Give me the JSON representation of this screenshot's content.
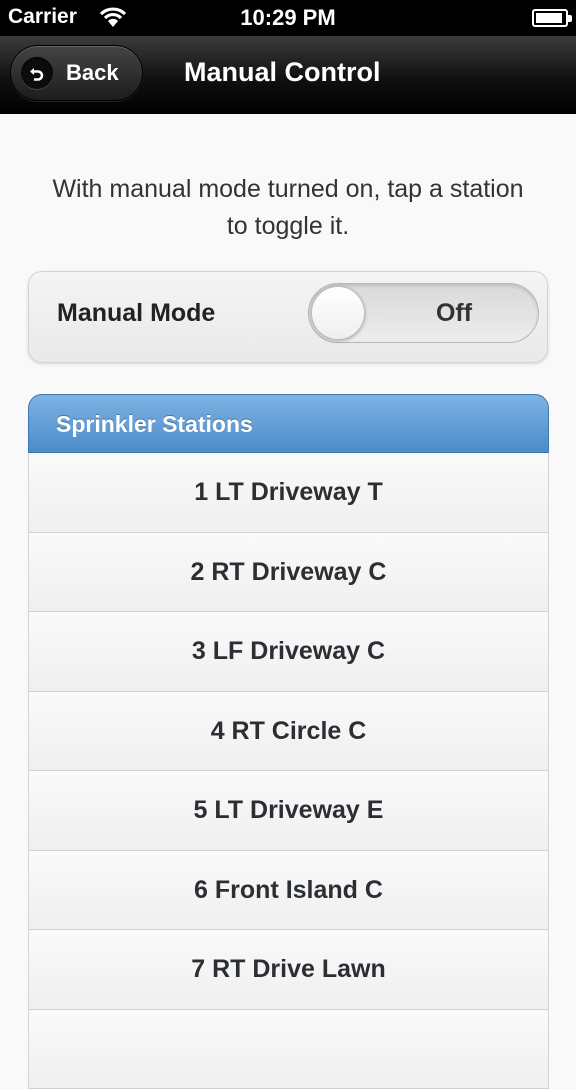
{
  "status_bar": {
    "carrier": "Carrier",
    "time": "10:29 PM"
  },
  "nav": {
    "back_label": "Back",
    "title": "Manual Control"
  },
  "instructions": "With manual mode turned on, tap a station to toggle it.",
  "manual_mode": {
    "label": "Manual Mode",
    "state": "Off"
  },
  "stations": {
    "header": "Sprinkler Stations",
    "items": [
      "1 LT Driveway T",
      "2 RT Driveway C",
      "3 LF Driveway C",
      "4 RT Circle C",
      "5 LT Driveway E",
      "6 Front Island C",
      "7 RT Drive Lawn",
      ""
    ]
  }
}
